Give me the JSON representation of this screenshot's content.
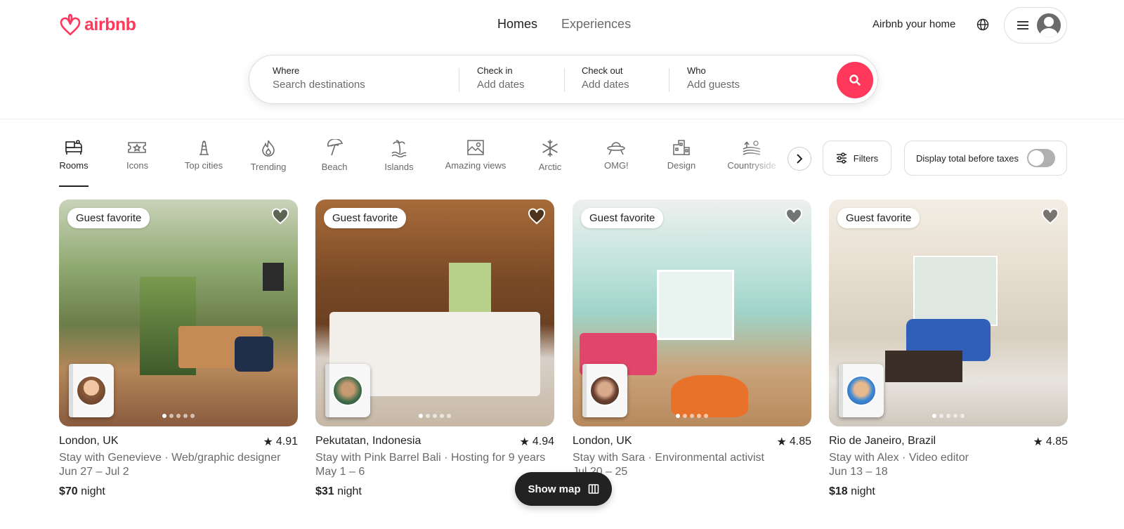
{
  "header": {
    "logo_text": "airbnb",
    "tabs": [
      {
        "label": "Homes",
        "active": true
      },
      {
        "label": "Experiences",
        "active": false
      }
    ],
    "host_link": "Airbnb your home"
  },
  "search": {
    "fields": [
      {
        "label": "Where",
        "placeholder": "Search destinations"
      },
      {
        "label": "Check in",
        "placeholder": "Add dates"
      },
      {
        "label": "Check out",
        "placeholder": "Add dates"
      },
      {
        "label": "Who",
        "placeholder": "Add guests"
      }
    ]
  },
  "categories": [
    {
      "label": "Rooms",
      "icon": "bed-icon",
      "active": true
    },
    {
      "label": "Icons",
      "icon": "ticket-icon"
    },
    {
      "label": "Top cities",
      "icon": "tower-icon"
    },
    {
      "label": "Trending",
      "icon": "flame-icon"
    },
    {
      "label": "Beach",
      "icon": "umbrella-icon"
    },
    {
      "label": "Islands",
      "icon": "island-icon"
    },
    {
      "label": "Amazing views",
      "icon": "view-icon"
    },
    {
      "label": "Arctic",
      "icon": "snowflake-icon"
    },
    {
      "label": "OMG!",
      "icon": "ufo-icon"
    },
    {
      "label": "Design",
      "icon": "building-icon"
    },
    {
      "label": "Countryside",
      "icon": "fields-icon"
    }
  ],
  "filters_label": "Filters",
  "tax_toggle_label": "Display total before taxes",
  "listings": [
    {
      "badge": "Guest favorite",
      "location": "London, UK",
      "rating": "4.91",
      "host_line": "Stay with Genevieve · Web/graphic designer",
      "dates": "Jun 27 – Jul 2",
      "price": "$70",
      "price_unit": "night"
    },
    {
      "badge": "Guest favorite",
      "location": "Pekutatan, Indonesia",
      "rating": "4.94",
      "host_line": "Stay with Pink Barrel Bali · Hosting for 9 years",
      "dates": "May 1 – 6",
      "price": "$31",
      "price_unit": "night"
    },
    {
      "badge": "Guest favorite",
      "location": "London, UK",
      "rating": "4.85",
      "host_line": "Stay with Sara · Environmental activist",
      "dates": "Jul 20 – 25",
      "price": "",
      "price_unit": "night"
    },
    {
      "badge": "Guest favorite",
      "location": "Rio de Janeiro, Brazil",
      "rating": "4.85",
      "host_line": "Stay with Alex · Video editor",
      "dates": "Jun 13 – 18",
      "price": "$18",
      "price_unit": "night"
    }
  ],
  "map_button": "Show map",
  "colors": {
    "brand": "#ff385c",
    "text": "#222222",
    "muted": "#6a6a6a"
  }
}
